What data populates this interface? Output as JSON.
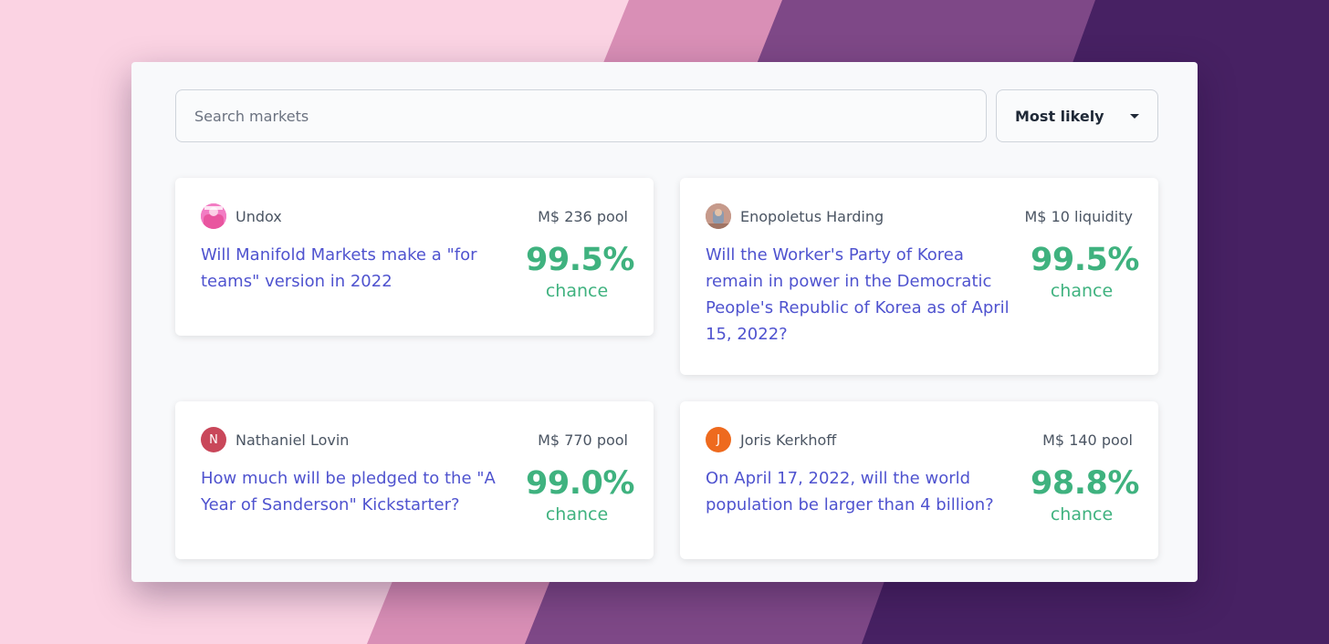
{
  "search": {
    "placeholder": "Search markets",
    "value": ""
  },
  "sort": {
    "selected": "Most likely"
  },
  "colors": {
    "question": "#4f53cf",
    "probability": "#3fb27f",
    "panel_background": "#f8f9fb"
  },
  "markets": [
    {
      "creator": "Undox",
      "avatar": {
        "type": "image",
        "color": "#ef6fbd"
      },
      "pool": "M$ 236 pool",
      "question": "Will Manifold Markets make a \"for teams\" version in 2022",
      "probability": "99.5%",
      "probability_label": "chance"
    },
    {
      "creator": "Enopoletus Harding",
      "avatar": {
        "type": "image",
        "color": "#b98a7e"
      },
      "pool": "M$ 10 liquidity",
      "question": "Will the Worker's Party of Korea remain in power in the Democratic People's Republic of Korea as of April 15, 2022?",
      "probability": "99.5%",
      "probability_label": "chance"
    },
    {
      "creator": "Nathaniel Lovin",
      "avatar": {
        "type": "initial",
        "initial": "N",
        "color": "#c9475a"
      },
      "pool": "M$ 770 pool",
      "question": "How much will be pledged to the \"A Year of Sanderson\" Kickstarter?",
      "probability": "99.0%",
      "probability_label": "chance"
    },
    {
      "creator": "Joris Kerkhoff",
      "avatar": {
        "type": "initial",
        "initial": "J",
        "color": "#ee6a1e"
      },
      "pool": "M$ 140 pool",
      "question": "On April 17, 2022, will the world population be larger than 4 billion?",
      "probability": "98.8%",
      "probability_label": "chance"
    }
  ]
}
